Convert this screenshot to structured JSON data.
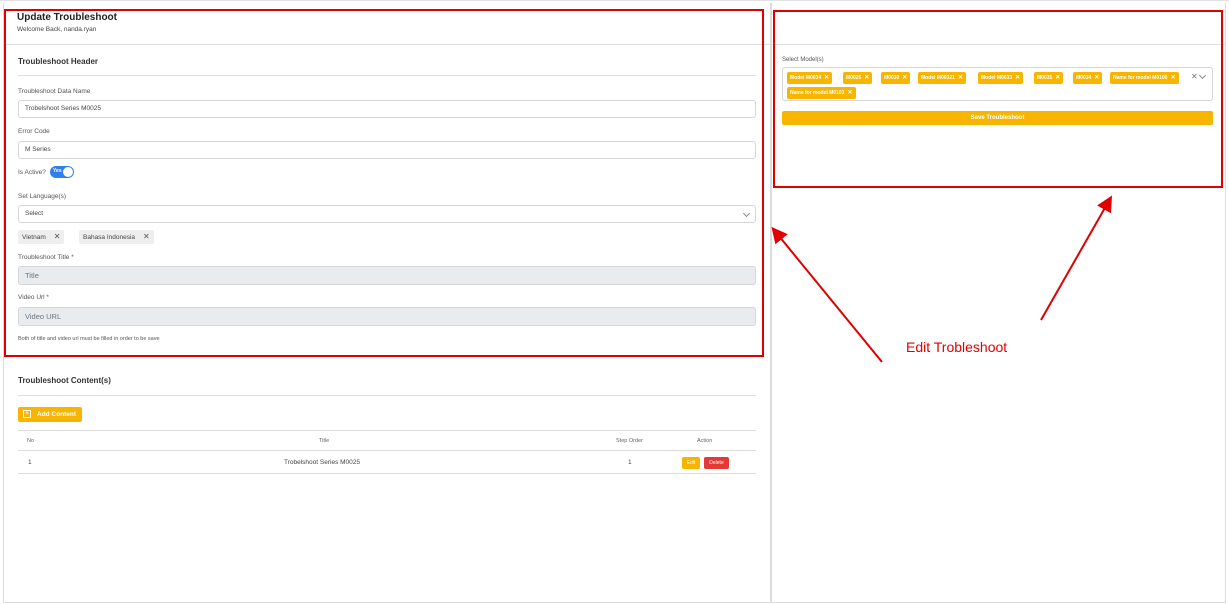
{
  "header": {
    "title": "Update Troubleshoot",
    "welcome": "Welcome Back, nanda.ryan"
  },
  "troubleshoot_header": {
    "section_title": "Troubleshoot Header",
    "data_name": {
      "label": "Troubleshoot Data Name",
      "value": "Trobelshoot Series M0025"
    },
    "error_code": {
      "label": "Error Code",
      "value": "M Series"
    },
    "is_active": {
      "label": "Is Active?",
      "toggle_text": "Yes"
    },
    "language": {
      "label": "Set Language(s)",
      "placeholder": "Select",
      "selected": [
        "Vietnam",
        "Bahasa Indonesia"
      ],
      "remove_symbol": "✕"
    },
    "title_field": {
      "label": "Troubleshoot Title *",
      "placeholder": "Title"
    },
    "video_field": {
      "label": "Video Url *",
      "placeholder": "Video URL"
    },
    "hint": "Both of title and video url must be filled in order to be save"
  },
  "contents": {
    "section_title": "Troubleshoot Content(s)",
    "add_button": "Add Content",
    "add_icon": "+",
    "columns": [
      "No",
      "Title",
      "Step Order",
      "Action"
    ],
    "rows": [
      {
        "no": "1",
        "title": "Trobelshoot Series M0025",
        "step_order": "1",
        "edit": "Edit",
        "delete": "Delete"
      }
    ]
  },
  "models": {
    "label": "Select Model(s)",
    "chips": [
      "Model M0034",
      "M0025",
      "M0030",
      "Model M00321",
      "Model M0033",
      "M0035",
      "M0034",
      "Name for model M0100",
      "Name for model M0101"
    ],
    "remove_symbol": "✕",
    "clear_symbol": "✕",
    "save_button": "Save Troubleshoot"
  },
  "annotation": {
    "text": "Edit Trobleshoot",
    "color": "#e00000"
  },
  "colors": {
    "accent": "#f7b500",
    "toggle": "#2f80ed",
    "danger": "#e53935"
  }
}
